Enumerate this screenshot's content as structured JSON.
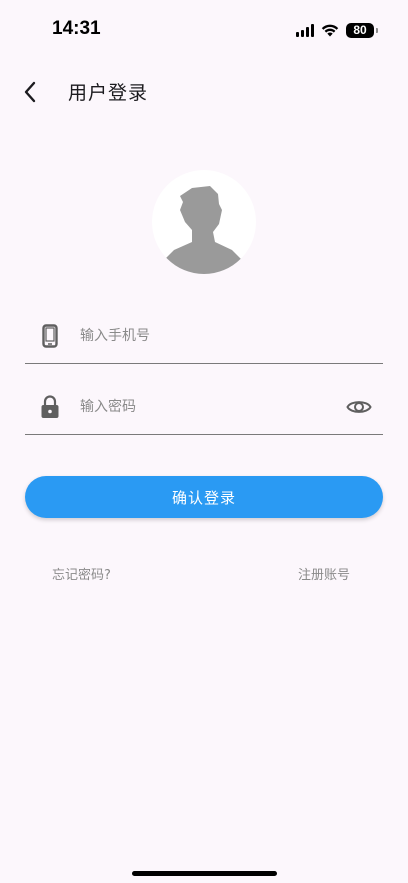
{
  "status_bar": {
    "time": "14:31",
    "battery": "80"
  },
  "app_bar": {
    "title": "用户登录"
  },
  "form": {
    "phone_placeholder": "输入手机号",
    "password_placeholder": "输入密码",
    "confirm_label": "确认登录"
  },
  "links": {
    "forgot": "忘记密码?",
    "register": "注册账号"
  },
  "colors": {
    "accent": "#2a9af3",
    "background": "#fcf7fc",
    "icon": "#5f5f5f"
  },
  "icons": [
    "back-arrow-icon",
    "phone-icon",
    "lock-icon",
    "eye-icon",
    "signal-icon",
    "wifi-icon",
    "battery-icon"
  ]
}
